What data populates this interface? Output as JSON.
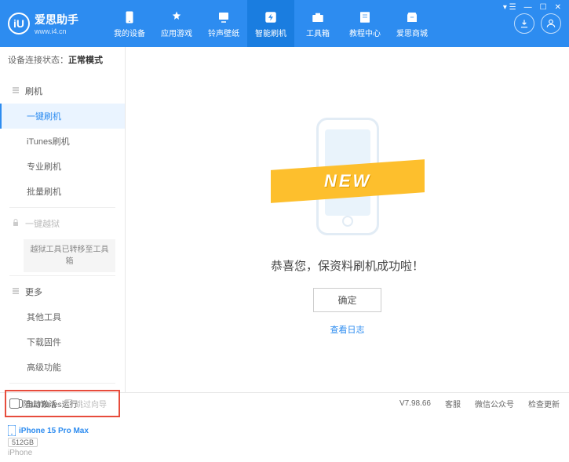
{
  "app": {
    "title": "爱思助手",
    "url": "www.i4.cn",
    "logo_letter": "iU"
  },
  "nav": [
    {
      "label": "我的设备",
      "icon": "device"
    },
    {
      "label": "应用游戏",
      "icon": "apps"
    },
    {
      "label": "铃声壁纸",
      "icon": "ringtone"
    },
    {
      "label": "智能刷机",
      "icon": "flash",
      "active": true
    },
    {
      "label": "工具箱",
      "icon": "toolbox"
    },
    {
      "label": "教程中心",
      "icon": "tutorial"
    },
    {
      "label": "爱思商城",
      "icon": "store"
    }
  ],
  "sidebar": {
    "conn_label": "设备连接状态：",
    "conn_value": "正常模式",
    "groups": [
      {
        "key": "flash",
        "label": "刷机",
        "items": [
          {
            "label": "一键刷机",
            "active": true
          },
          {
            "label": "iTunes刷机"
          },
          {
            "label": "专业刷机"
          },
          {
            "label": "批量刷机"
          }
        ]
      },
      {
        "key": "jailbreak",
        "label": "一键越狱",
        "locked": true,
        "items": [
          {
            "label": "越狱工具已转移至工具箱",
            "boxed": true
          }
        ]
      },
      {
        "key": "more",
        "label": "更多",
        "items": [
          {
            "label": "其他工具"
          },
          {
            "label": "下载固件"
          },
          {
            "label": "高级功能"
          }
        ]
      }
    ],
    "checkboxes": {
      "auto_activate": "自动激活",
      "skip_setup": "跳过向导"
    }
  },
  "device": {
    "name": "iPhone 15 Pro Max",
    "storage": "512GB",
    "type": "iPhone"
  },
  "main": {
    "ribbon": "NEW",
    "success_text": "恭喜您，保资料刷机成功啦！",
    "ok_button": "确定",
    "view_log": "查看日志"
  },
  "footer": {
    "block_itunes": "阻止iTunes运行",
    "version": "V7.98.66",
    "links": [
      "客服",
      "微信公众号",
      "检查更新"
    ]
  }
}
